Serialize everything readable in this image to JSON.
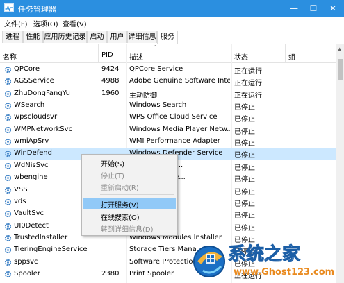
{
  "window": {
    "title": "任务管理器",
    "controls": {
      "minimize": "—",
      "maximize": "☐",
      "close": "✕"
    }
  },
  "menu": [
    "文件(F)",
    "选项(O)",
    "查看(V)"
  ],
  "tabs": [
    "进程",
    "性能",
    "应用历史记录",
    "启动",
    "用户",
    "详细信息",
    "服务"
  ],
  "active_tab": "服务",
  "columns": [
    "名称",
    "PID",
    "描述",
    "状态",
    "组"
  ],
  "rows": [
    {
      "name": "QPCore",
      "pid": "9424",
      "desc": "QPCore Service",
      "status": "正在运行"
    },
    {
      "name": "AGSService",
      "pid": "4988",
      "desc": "Adobe Genuine Software Inte...",
      "status": "正在运行"
    },
    {
      "name": "ZhuDongFangYu",
      "pid": "1960",
      "desc": "主动防御",
      "status": "正在运行"
    },
    {
      "name": "WSearch",
      "pid": "",
      "desc": "Windows Search",
      "status": "已停止"
    },
    {
      "name": "wpscloudsvr",
      "pid": "",
      "desc": "WPS Office Cloud Service",
      "status": "已停止"
    },
    {
      "name": "WMPNetworkSvc",
      "pid": "",
      "desc": "Windows Media Player Netw...",
      "status": "已停止"
    },
    {
      "name": "wmiApSrv",
      "pid": "",
      "desc": "WMI Performance Adapter",
      "status": "已停止"
    },
    {
      "name": "WinDefend",
      "pid": "",
      "desc": "Windows Defender Service",
      "status": "已停止"
    },
    {
      "name": "WdNisSvc",
      "pid": "",
      "desc": "der Network I...",
      "status": "已停止"
    },
    {
      "name": "wbengine",
      "pid": "",
      "desc": "kup Engine Se...",
      "status": "已停止"
    },
    {
      "name": "VSS",
      "pid": "",
      "desc": "y Copy",
      "status": "已停止"
    },
    {
      "name": "vds",
      "pid": "",
      "desc": "",
      "status": "已停止"
    },
    {
      "name": "VaultSvc",
      "pid": "",
      "desc": "ager",
      "status": "已停止"
    },
    {
      "name": "UI0Detect",
      "pid": "",
      "desc": "ces Detection",
      "status": "已停止"
    },
    {
      "name": "TrustedInstaller",
      "pid": "",
      "desc": "Windows Modules Installer",
      "status": "已停止"
    },
    {
      "name": "TieringEngineService",
      "pid": "",
      "desc": "Storage Tiers Mana",
      "status": "已停止"
    },
    {
      "name": "sppsvc",
      "pid": "",
      "desc": "Software Protection",
      "status": "已停止"
    },
    {
      "name": "Spooler",
      "pid": "2380",
      "desc": "Print Spooler",
      "status": "正在运行"
    }
  ],
  "selected_row": "WinDefend",
  "context_menu": [
    {
      "label": "开始(S)",
      "disabled": false
    },
    {
      "label": "停止(T)",
      "disabled": true
    },
    {
      "label": "重新启动(R)",
      "disabled": true
    },
    {
      "label": "打开服务(V)",
      "disabled": false,
      "highlighted": true
    },
    {
      "label": "在线搜索(O)",
      "disabled": false
    },
    {
      "label": "转到详细信息(D)",
      "disabled": true
    }
  ],
  "watermark": {
    "title": "系统之家",
    "url": "www.Ghost123.com"
  },
  "colors": {
    "titlebar": "#2b8fe0",
    "selection": "#cce8ff",
    "menu_highlight": "#91c9f7",
    "icon": "#3a7fc4"
  }
}
